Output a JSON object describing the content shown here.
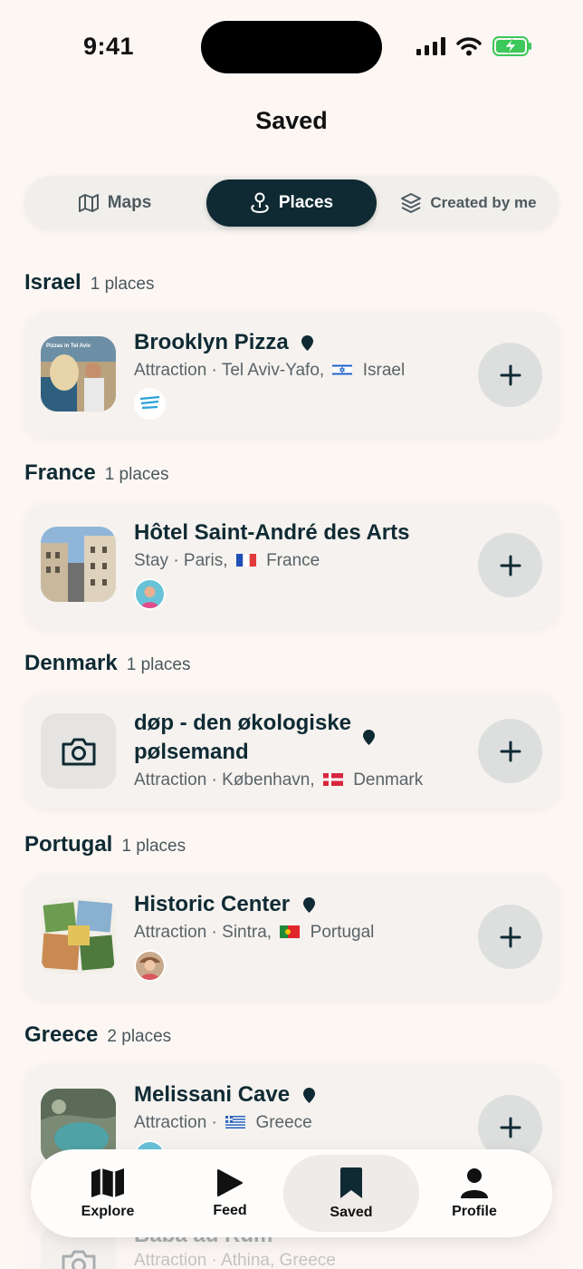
{
  "status": {
    "time": "9:41"
  },
  "header": {
    "title": "Saved"
  },
  "segments": [
    {
      "label": "Maps",
      "icon": "map-icon"
    },
    {
      "label": "Places",
      "icon": "pin-icon",
      "active": true
    },
    {
      "label": "Created by me",
      "icon": "layers-icon"
    }
  ],
  "sections": [
    {
      "country": "Israel",
      "count": "1 places",
      "place": {
        "name": "Brooklyn Pizza",
        "category": "Attraction",
        "city": "Tel Aviv-Yafo,",
        "flag": "israel-flag",
        "country": "Israel",
        "thumb_caption": "Pizzas in Tel Aviv"
      }
    },
    {
      "country": "France",
      "count": "1 places",
      "place": {
        "name": "Hôtel Saint-André des Arts",
        "category": "Stay",
        "city": "Paris,",
        "flag": "france-flag",
        "country": "France"
      }
    },
    {
      "country": "Denmark",
      "count": "1 places",
      "place": {
        "name_line1": "døp - den økologiske",
        "name_line2": "pølsemand",
        "category": "Attraction",
        "city": "København,",
        "flag": "denmark-flag",
        "country": "Denmark"
      }
    },
    {
      "country": "Portugal",
      "count": "1 places",
      "place": {
        "name": "Historic Center",
        "category": "Attraction",
        "city": "Sintra,",
        "flag": "portugal-flag",
        "country": "Portugal"
      }
    },
    {
      "country": "Greece",
      "count": "2 places",
      "places": [
        {
          "name": "Melissani Cave",
          "category": "Attraction",
          "city": "",
          "flag": "greece-flag",
          "country": "Greece"
        },
        {
          "name": "Baba au Rum",
          "category": "Attraction",
          "city": "Athina,",
          "flag": "greece-flag",
          "country": "Greece"
        }
      ]
    }
  ],
  "separator": "·",
  "tabbar": [
    {
      "label": "Explore",
      "icon": "map-icon"
    },
    {
      "label": "Feed",
      "icon": "play-icon"
    },
    {
      "label": "Saved",
      "icon": "bookmark-icon",
      "active": true
    },
    {
      "label": "Profile",
      "icon": "person-icon"
    }
  ],
  "colors": {
    "primary": "#0f2a33",
    "background": "#fdf7f4",
    "card": "#f5f2ef",
    "add_button": "#dddfdf",
    "battery": "#3cc85a"
  }
}
